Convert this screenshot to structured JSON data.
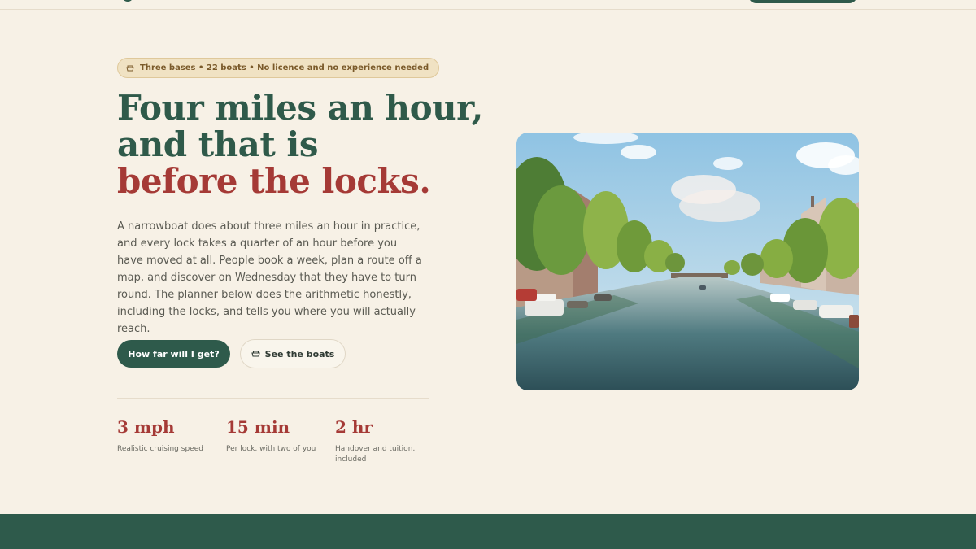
{
  "badge": {
    "text": "Three bases • 22 boats • No licence and no experience needed",
    "icon": "boat-icon"
  },
  "headline": {
    "line1": "Four miles an hour,",
    "line2": "and that is",
    "line3": "before the locks."
  },
  "lede": "A narrowboat does about three miles an hour in practice, and every lock takes a quarter of an hour before you have moved at all. People book a week, plan a route off a map, and discover on Wednesday that they have to turn round. The planner below does the arithmetic honestly, including the locks, and tells you where you will actually reach.",
  "buttons": {
    "primary": "How far will I get?",
    "secondary": "See the boats",
    "secondary_icon": "boat-icon"
  },
  "stats": [
    {
      "value": "3 mph",
      "label": "Realistic cruising speed"
    },
    {
      "value": "15 min",
      "label": "Per lock, with two of you"
    },
    {
      "value": "2 hr",
      "label": "Handover and tuition, included"
    }
  ],
  "colors": {
    "background": "#f7f1e6",
    "brand_green": "#2e5a4b",
    "accent_red": "#a53a36",
    "badge_bg": "#f0e2c3"
  }
}
